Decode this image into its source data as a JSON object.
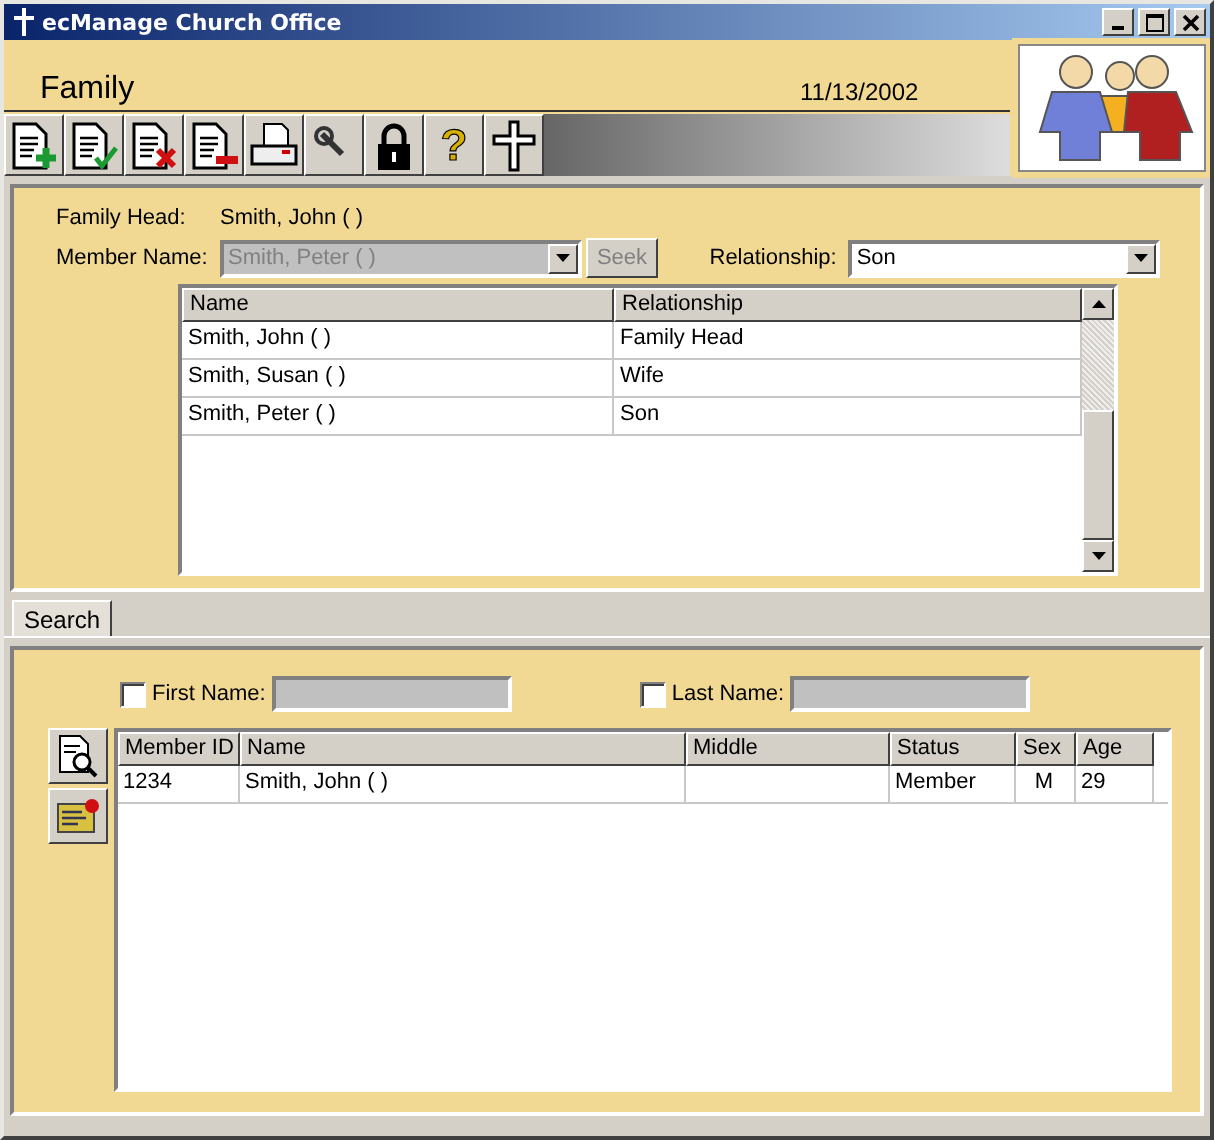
{
  "window": {
    "title": "ecManage Church Office"
  },
  "header": {
    "title": "Family",
    "date": "11/13/2002"
  },
  "toolbar": [
    {
      "kind": "add"
    },
    {
      "kind": "save"
    },
    {
      "kind": "delete"
    },
    {
      "kind": "remove"
    },
    {
      "kind": "print"
    },
    {
      "kind": "tools"
    },
    {
      "kind": "lock"
    },
    {
      "kind": "help",
      "glyph": "?"
    },
    {
      "kind": "cross"
    }
  ],
  "family": {
    "head_label": "Family Head:",
    "head_value": "Smith, John (  )",
    "member_label": "Member Name:",
    "member_value": "Smith, Peter (  )",
    "member_disabled": true,
    "seek": {
      "label": "Seek",
      "disabled": true
    },
    "relationship_label": "Relationship:",
    "relationship_value": "Son",
    "columns": [
      "Name",
      "Relationship"
    ],
    "rows": [
      [
        "Smith, John (  )",
        "Family Head"
      ],
      [
        "Smith, Susan (  )",
        "Wife"
      ],
      [
        "Smith, Peter (  )",
        "Son"
      ]
    ]
  },
  "tabs": [
    {
      "label": "Search",
      "selected": true
    }
  ],
  "search": {
    "fields": [
      {
        "label": "First Name:",
        "checked": false,
        "disabled": true
      },
      {
        "label": "Last Name:",
        "checked": false,
        "disabled": true
      }
    ],
    "side_buttons": [
      {
        "kind": "find"
      },
      {
        "kind": "edit"
      }
    ],
    "columns": [
      "Member ID",
      "Name",
      "Middle",
      "Status",
      "Sex",
      "Age"
    ],
    "rows": [
      [
        "1234",
        "Smith, John (  )",
        "",
        "Member",
        "M",
        "29"
      ]
    ]
  }
}
